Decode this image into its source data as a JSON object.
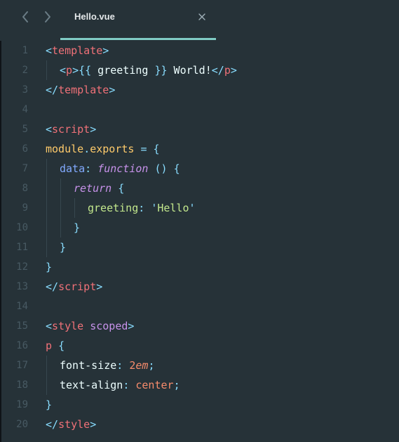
{
  "tab": {
    "title": "Hello.vue"
  },
  "icons": {
    "back": "chevron-left-icon",
    "forward": "chevron-right-icon",
    "close": "close-icon"
  },
  "colors": {
    "background": "#263238",
    "tab_accent": "#80cbc4",
    "tag": "#f07178",
    "punctuation": "#89ddff",
    "keyword": "#c792ea",
    "string": "#c3e88d",
    "number": "#f78c6c",
    "property": "#82aaff",
    "identifier": "#ffcb6b"
  },
  "lines": [
    {
      "n": "1",
      "indent": 0,
      "tokens": [
        [
          "punct",
          "<"
        ],
        [
          "tag",
          "template"
        ],
        [
          "punct",
          ">"
        ]
      ]
    },
    {
      "n": "2",
      "indent": 1,
      "tokens": [
        [
          "punct",
          "<"
        ],
        [
          "tag",
          "p"
        ],
        [
          "punct",
          ">{{"
        ],
        [
          "text",
          " greeting "
        ],
        [
          "punct",
          "}}"
        ],
        [
          "text",
          " World!"
        ],
        [
          "punct",
          "</"
        ],
        [
          "tag",
          "p"
        ],
        [
          "punct",
          ">"
        ]
      ]
    },
    {
      "n": "3",
      "indent": 0,
      "tokens": [
        [
          "punct",
          "</"
        ],
        [
          "tag",
          "template"
        ],
        [
          "punct",
          ">"
        ]
      ]
    },
    {
      "n": "4",
      "indent": 0,
      "tokens": []
    },
    {
      "n": "5",
      "indent": 0,
      "tokens": [
        [
          "punct",
          "<"
        ],
        [
          "tag",
          "script"
        ],
        [
          "punct",
          ">"
        ]
      ]
    },
    {
      "n": "6",
      "indent": 0,
      "tokens": [
        [
          "ident",
          "module"
        ],
        [
          "punct",
          "."
        ],
        [
          "ident",
          "exports"
        ],
        [
          "text",
          " "
        ],
        [
          "punct",
          "="
        ],
        [
          "text",
          " "
        ],
        [
          "punct",
          "{"
        ]
      ]
    },
    {
      "n": "7",
      "indent": 1,
      "tokens": [
        [
          "key",
          "data"
        ],
        [
          "punct",
          ":"
        ],
        [
          "text",
          " "
        ],
        [
          "kw",
          "function"
        ],
        [
          "text",
          " "
        ],
        [
          "punct",
          "()"
        ],
        [
          "text",
          " "
        ],
        [
          "punct",
          "{"
        ]
      ]
    },
    {
      "n": "8",
      "indent": 2,
      "tokens": [
        [
          "kw",
          "return"
        ],
        [
          "text",
          " "
        ],
        [
          "punct",
          "{"
        ]
      ]
    },
    {
      "n": "9",
      "indent": 3,
      "tokens": [
        [
          "str",
          "greeting"
        ],
        [
          "punct",
          ":"
        ],
        [
          "text",
          " "
        ],
        [
          "punct",
          "'"
        ],
        [
          "str",
          "Hello"
        ],
        [
          "punct",
          "'"
        ]
      ]
    },
    {
      "n": "10",
      "indent": 2,
      "tokens": [
        [
          "punct",
          "}"
        ]
      ]
    },
    {
      "n": "11",
      "indent": 1,
      "tokens": [
        [
          "punct",
          "}"
        ]
      ]
    },
    {
      "n": "12",
      "indent": 0,
      "tokens": [
        [
          "punct",
          "}"
        ]
      ]
    },
    {
      "n": "13",
      "indent": 0,
      "tokens": [
        [
          "punct",
          "</"
        ],
        [
          "tag",
          "script"
        ],
        [
          "punct",
          ">"
        ]
      ]
    },
    {
      "n": "14",
      "indent": 0,
      "tokens": []
    },
    {
      "n": "15",
      "indent": 0,
      "tokens": [
        [
          "punct",
          "<"
        ],
        [
          "tag",
          "style"
        ],
        [
          "text",
          " "
        ],
        [
          "attr",
          "scoped"
        ],
        [
          "punct",
          ">"
        ]
      ]
    },
    {
      "n": "16",
      "indent": 0,
      "tokens": [
        [
          "sel",
          "p"
        ],
        [
          "text",
          " "
        ],
        [
          "punct",
          "{"
        ]
      ]
    },
    {
      "n": "17",
      "indent": 1,
      "tokens": [
        [
          "text",
          "font-size"
        ],
        [
          "punct",
          ":"
        ],
        [
          "text",
          " "
        ],
        [
          "num",
          "2"
        ],
        [
          "unit",
          "em"
        ],
        [
          "punct",
          ";"
        ]
      ]
    },
    {
      "n": "18",
      "indent": 1,
      "tokens": [
        [
          "text",
          "text-align"
        ],
        [
          "punct",
          ":"
        ],
        [
          "text",
          " "
        ],
        [
          "num",
          "center"
        ],
        [
          "punct",
          ";"
        ]
      ]
    },
    {
      "n": "19",
      "indent": 0,
      "tokens": [
        [
          "punct",
          "}"
        ]
      ]
    },
    {
      "n": "20",
      "indent": 0,
      "tokens": [
        [
          "punct",
          "</"
        ],
        [
          "tag",
          "style"
        ],
        [
          "punct",
          ">"
        ]
      ]
    }
  ]
}
